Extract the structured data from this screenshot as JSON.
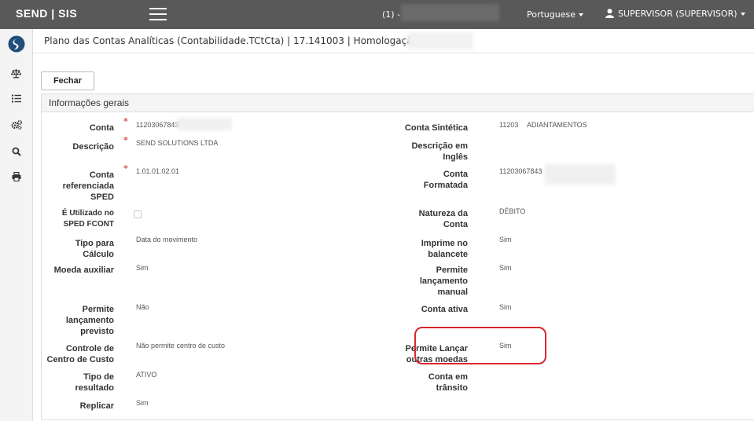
{
  "topbar": {
    "brand": "SEND | SIS",
    "connection_prefix": "(1) -",
    "language": "Portuguese",
    "user": "SUPERVISOR (SUPERVISOR)"
  },
  "sidebar": {
    "items": [
      {
        "icon": "app-logo-icon"
      },
      {
        "icon": "scale-icon"
      },
      {
        "icon": "list-icon"
      },
      {
        "icon": "gears-icon"
      },
      {
        "icon": "search-icon"
      },
      {
        "icon": "print-icon"
      }
    ]
  },
  "page": {
    "title": "Plano das Contas Analíticas (Contabilidade.TCtCta) | 17.141003 | Homologação |",
    "close_button": "Fechar",
    "section_title": "Informações gerais"
  },
  "fields": {
    "conta": {
      "label": "Conta",
      "value": "11203067843"
    },
    "descricao": {
      "label": "Descrição",
      "value": "SEND SOLUTIONS LTDA"
    },
    "conta_ref_sped": {
      "label_1": "Conta",
      "label_2": "referenciada",
      "label_3": "SPED",
      "value": "1.01.01.02.01"
    },
    "utilizado_fcont": {
      "label_1": "É Utilizado no",
      "label_2": "SPED FCONT",
      "value": false
    },
    "tipo_calculo": {
      "label_1": "Tipo para",
      "label_2": "Cálculo",
      "value": "Data do movimento"
    },
    "moeda_auxiliar": {
      "label": "Moeda auxiliar",
      "value": "Sim"
    },
    "lanc_previsto": {
      "label_1": "Permite",
      "label_2": "lançamento",
      "label_3": "previsto",
      "value": "Não"
    },
    "centro_custo": {
      "label_1": "Controle de",
      "label_2": "Centro de Custo",
      "value": "Não permite centro de custo"
    },
    "tipo_resultado": {
      "label_1": "Tipo de",
      "label_2": "resultado",
      "value": "ATIVO"
    },
    "replicar": {
      "label": "Replicar",
      "value": "Sim"
    },
    "conta_sintetica": {
      "label": "Conta Sintética",
      "value_code": "11203",
      "value_desc": "ADIANTAMENTOS"
    },
    "desc_ingles": {
      "label_1": "Descrição em",
      "label_2": "Inglês",
      "value": ""
    },
    "conta_formatada": {
      "label_1": "Conta",
      "label_2": "Formatada",
      "value": "11203067843"
    },
    "natureza": {
      "label_1": "Natureza da",
      "label_2": "Conta",
      "value": "DÉBITO"
    },
    "imprime_balancete": {
      "label_1": "Imprime no",
      "label_2": "balancete",
      "value": "Sim"
    },
    "lanc_manual": {
      "label_1": "Permite",
      "label_2": "lançamento",
      "label_3": "manual",
      "value": "Sim"
    },
    "conta_ativa": {
      "label": "Conta ativa",
      "value": "Sim"
    },
    "outras_moedas": {
      "label_1": "Permite Lançar",
      "label_2": "outras moedas",
      "value": "Sim"
    },
    "conta_transito": {
      "label_1": "Conta em",
      "label_2": "trânsito",
      "value": ""
    }
  },
  "colors": {
    "topbar": "#595959",
    "required": "#d9534f",
    "highlight": "#d9282f"
  }
}
